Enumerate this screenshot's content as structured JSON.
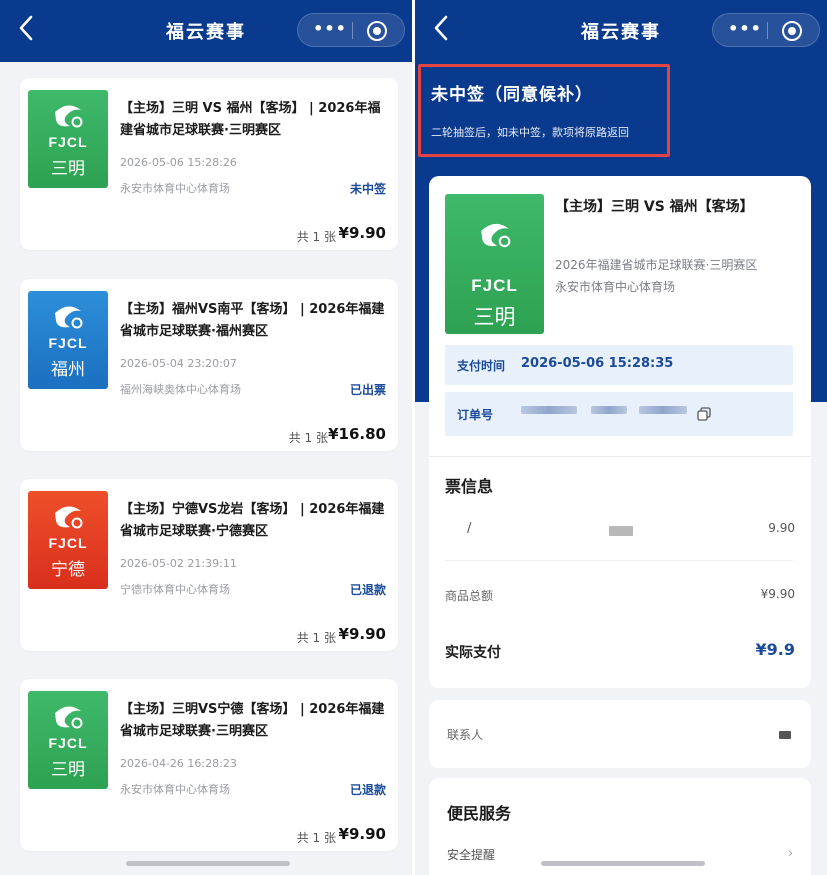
{
  "left": {
    "nav": {
      "title": "福云赛事",
      "more": "•••"
    },
    "orders": [
      {
        "title": "【主场】三明 VS 福州【客场】 | 2026年福建省城市足球联赛·三明赛区",
        "logo_text": "FJCL",
        "logo_city": "三明",
        "logo_color": "green",
        "time": "2026-05-06 15:28:26",
        "venue": "永安市体育中心体育场",
        "status": "未中签",
        "qty": "共 1 张",
        "price": "¥9.90"
      },
      {
        "title": "【主场】福州VS南平【客场】 | 2026年福建省城市足球联赛·福州赛区",
        "logo_text": "FJCL",
        "logo_city": "福州",
        "logo_color": "blue",
        "time": "2026-05-04 23:20:07",
        "venue": "福州海峡奥体中心体育场",
        "status": "已出票",
        "qty": "共 1 张",
        "price": "¥16.80"
      },
      {
        "title": "【主场】宁德VS龙岩【客场】 | 2026年福建省城市足球联赛·宁德赛区",
        "logo_text": "FJCL",
        "logo_city": "宁德",
        "logo_color": "red",
        "time": "2026-05-02 21:39:11",
        "venue": "宁德市体育中心体育场",
        "status": "已退款",
        "qty": "共 1 张",
        "price": "¥9.90"
      },
      {
        "title": "【主场】三明VS宁德【客场】 | 2026年福建省城市足球联赛·三明赛区",
        "logo_text": "FJCL",
        "logo_city": "三明",
        "logo_color": "green",
        "time": "2026-04-26 16:28:23",
        "venue": "永安市体育中心体育场",
        "status": "已退款",
        "qty": "共 1 张",
        "price": "¥9.90"
      }
    ]
  },
  "right": {
    "nav": {
      "title": "福云赛事",
      "more": "•••"
    },
    "status": {
      "title": "未中签（同意候补）",
      "desc": "二轮抽签后，如未中签，款项将原路返回"
    },
    "event": {
      "title": "【主场】三明 VS 福州【客场】",
      "logo_text": "FJCL",
      "logo_city": "三明",
      "league": "2026年福建省城市足球联赛·三明赛区",
      "venue": "永安市体育中心体育场"
    },
    "payment": {
      "label": "支付时间",
      "value": "2026-05-06 15:28:35"
    },
    "order": {
      "label": "订单号"
    },
    "tickets": {
      "heading": "票信息",
      "slash": "/",
      "price": "9.90"
    },
    "subtotal": {
      "label": "商品总额",
      "value": "¥9.90"
    },
    "paid": {
      "label": "实际支付",
      "value": "¥9.9"
    },
    "contact": {
      "label": "联系人"
    },
    "services": {
      "title": "便民服务",
      "first_item": "安全提醒"
    }
  },
  "colors": {
    "nav_blue": "#0a3a8e",
    "accent": "#1a4a9a",
    "highlight": "#e24444"
  }
}
